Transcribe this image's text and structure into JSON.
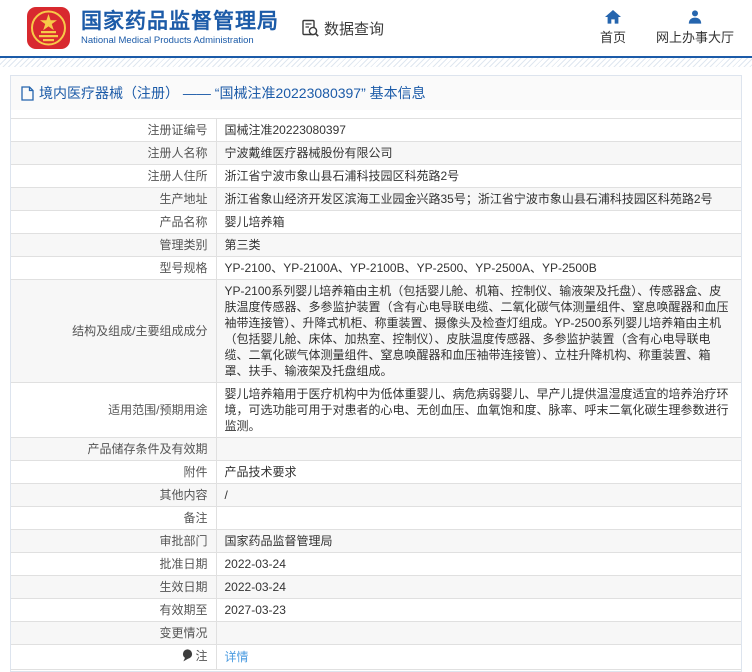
{
  "colors": {
    "accent_blue": "#1c5ba8",
    "header_line_blue": "#2b6cb0",
    "link_blue": "#4a9be0",
    "emblem_red": "#d8292f",
    "emblem_gold": "#f7c948"
  },
  "header": {
    "agency_title": "国家药品监督管理局",
    "agency_subtitle": "National Medical Products Administration",
    "data_query": "数据查询",
    "nav_home": "首页",
    "nav_hall": "网上办事大厅"
  },
  "breadcrumb": {
    "text": "境内医疗器械（注册） —— “国械注准20223080397” 基本信息"
  },
  "table": {
    "rows": [
      {
        "label": "注册证编号",
        "value": "国械注准20223080397"
      },
      {
        "label": "注册人名称",
        "value": "宁波戴维医疗器械股份有限公司"
      },
      {
        "label": "注册人住所",
        "value": "浙江省宁波市象山县石浦科技园区科苑路2号"
      },
      {
        "label": "生产地址",
        "value": "浙江省象山经济开发区滨海工业园金兴路35号；浙江省宁波市象山县石浦科技园区科苑路2号"
      },
      {
        "label": "产品名称",
        "value": "婴儿培养箱"
      },
      {
        "label": "管理类别",
        "value": "第三类"
      },
      {
        "label": "型号规格",
        "value": "YP-2100、YP-2100A、YP-2100B、YP-2500、YP-2500A、YP-2500B"
      },
      {
        "label": "结构及组成/主要组成成分",
        "value": "YP-2100系列婴儿培养箱由主机（包括婴儿舱、机箱、控制仪、输液架及托盘）、传感器盒、皮肤温度传感器、多参监护装置（含有心电导联电缆、二氧化碳气体测量组件、窒息唤醒器和血压袖带连接管）、升降式机柜、称重装置、摄像头及检查灯组成。YP-2500系列婴儿培养箱由主机（包括婴儿舱、床体、加热室、控制仪）、皮肤温度传感器、多参监护装置（含有心电导联电缆、二氧化碳气体测量组件、窒息唤醒器和血压袖带连接管）、立柱升降机构、称重装置、箱罩、扶手、输液架及托盘组成。"
      },
      {
        "label": "适用范围/预期用途",
        "value": "婴儿培养箱用于医疗机构中为低体重婴儿、病危病弱婴儿、早产儿提供温湿度适宜的培养治疗环境，可选功能可用于对患者的心电、无创血压、血氧饱和度、脉率、呼末二氧化碳生理参数进行监测。"
      },
      {
        "label": "产品储存条件及有效期",
        "value": ""
      },
      {
        "label": "附件",
        "value": "产品技术要求"
      },
      {
        "label": "其他内容",
        "value": "/"
      },
      {
        "label": "备注",
        "value": ""
      },
      {
        "label": "审批部门",
        "value": "国家药品监督管理局"
      },
      {
        "label": "批准日期",
        "value": "2022-03-24"
      },
      {
        "label": "生效日期",
        "value": "2022-03-24"
      },
      {
        "label": "有效期至",
        "value": "2027-03-23"
      },
      {
        "label": "变更情况",
        "value": ""
      },
      {
        "label": "注",
        "value": "详情",
        "link": true,
        "note_icon": true
      }
    ]
  }
}
